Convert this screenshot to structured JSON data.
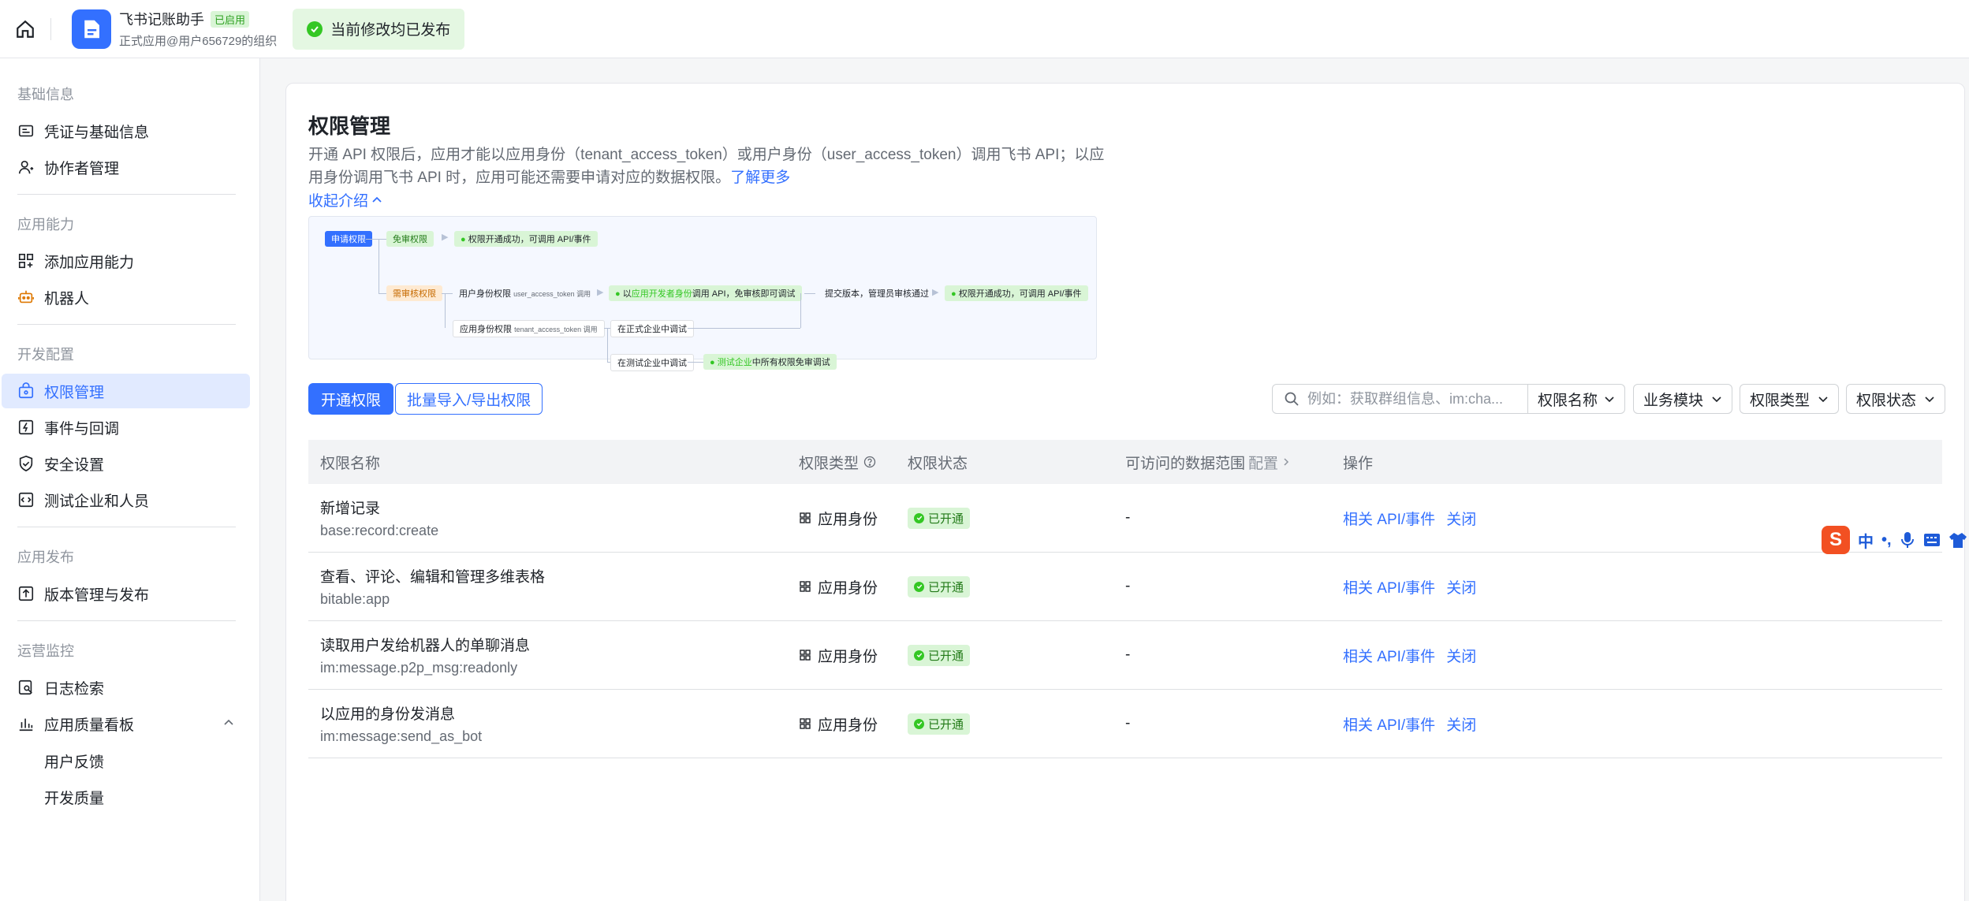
{
  "header": {
    "app_name": "飞书记账助手",
    "app_badge": "已启用",
    "app_subtitle": "正式应用@用户656729的组织",
    "publish_status": "当前修改均已发布"
  },
  "sidebar": {
    "groups": [
      {
        "title": "基础信息",
        "items": [
          "凭证与基础信息",
          "协作者管理"
        ]
      },
      {
        "title": "应用能力",
        "items": [
          "添加应用能力",
          "机器人"
        ]
      },
      {
        "title": "开发配置",
        "items": [
          "权限管理",
          "事件与回调",
          "安全设置",
          "测试企业和人员"
        ]
      },
      {
        "title": "应用发布",
        "items": [
          "版本管理与发布"
        ]
      },
      {
        "title": "运营监控",
        "items": [
          "日志检索",
          "应用质量看板"
        ],
        "subitems": [
          "用户反馈",
          "开发质量"
        ]
      }
    ]
  },
  "main": {
    "title": "权限管理",
    "intro": "开通 API 权限后，应用才能以应用身份（tenant_access_token）或用户身份（user_access_token）调用飞书 API；以应用身份调用飞书 API 时，应用可能还需要申请对应的数据权限。",
    "learn_more": "了解更多",
    "collapse": "收起介绍",
    "flow": {
      "apply": "申请权限",
      "no_review": "免审权限",
      "no_review_result": "权限开通成功，可调用 API/事件",
      "need_review": "需审核权限",
      "user_identity": "用户身份权限",
      "user_token": "user_access_token 调用",
      "dev_identity_pre": "以",
      "dev_identity": "应用开发者身份",
      "dev_identity_post": "调用 API，免审核即可调试",
      "submit": "提交版本，管理员审核通过",
      "final_result": "权限开通成功，可调用 API/事件",
      "app_identity": "应用身份权限",
      "tenant_token": "tenant_access_token 调用",
      "formal_debug": "在正式企业中调试",
      "test_debug": "在测试企业中调试",
      "test_free_pre": "测试企业",
      "test_free_post": "中所有权限免审调试"
    },
    "btn_open": "开通权限",
    "btn_batch": "批量导入/导出权限",
    "search_placeholder": "例如：获取群组信息、im:cha...",
    "filters": [
      "权限名称",
      "业务模块",
      "权限类型",
      "权限状态"
    ],
    "table": {
      "headers": {
        "name": "权限名称",
        "type": "权限类型",
        "status": "权限状态",
        "scope": "可访问的数据范围",
        "scope_hint": "配置",
        "actions": "操作"
      },
      "rows": [
        {
          "name": "新增记录",
          "code": "base:record:create",
          "type": "应用身份",
          "status": "已开通",
          "scope": "-",
          "action1": "相关 API/事件",
          "action2": "关闭"
        },
        {
          "name": "查看、评论、编辑和管理多维表格",
          "code": "bitable:app",
          "type": "应用身份",
          "status": "已开通",
          "scope": "-",
          "action1": "相关 API/事件",
          "action2": "关闭"
        },
        {
          "name": "读取用户发给机器人的单聊消息",
          "code": "im:message.p2p_msg:readonly",
          "type": "应用身份",
          "status": "已开通",
          "scope": "-",
          "action1": "相关 API/事件",
          "action2": "关闭"
        },
        {
          "name": "以应用的身份发消息",
          "code": "im:message:send_as_bot",
          "type": "应用身份",
          "status": "已开通",
          "scope": "-",
          "action1": "相关 API/事件",
          "action2": "关闭"
        }
      ]
    }
  },
  "ime": {
    "lang": "中",
    "punct": "•,"
  }
}
